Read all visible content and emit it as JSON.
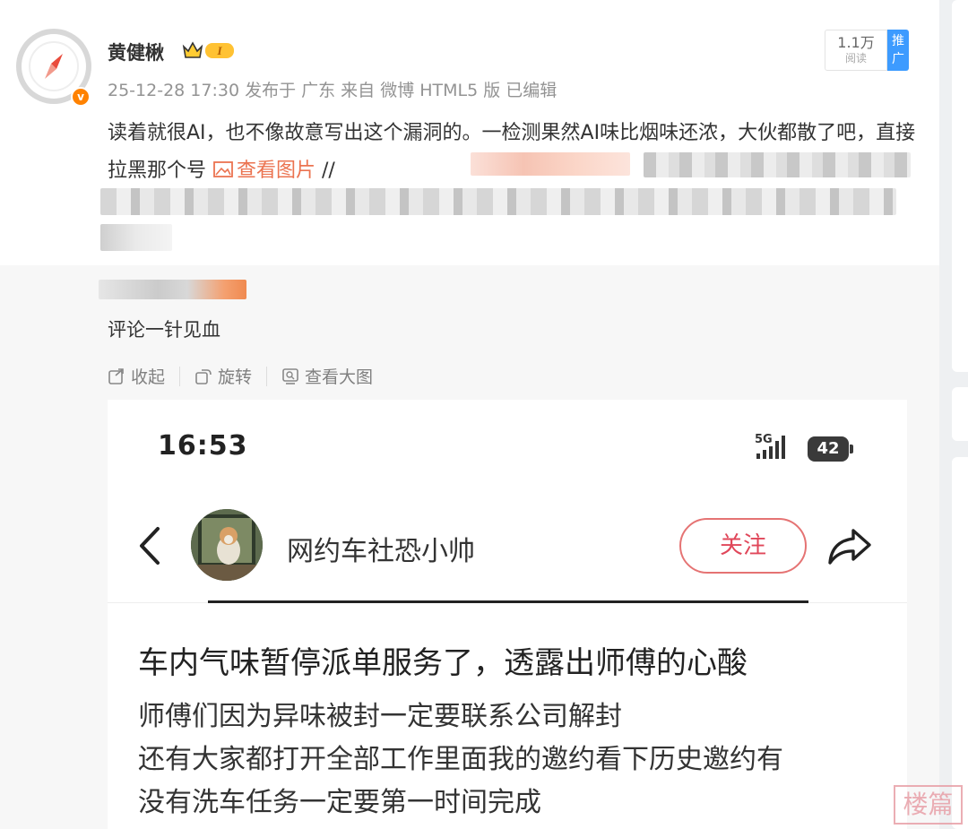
{
  "post": {
    "username": "黄健楸",
    "level_badge": "I",
    "meta": "25-12-28 17:30 发布于 广东 来自 微博 HTML5 版 已编辑",
    "read_count": "1.1万",
    "read_label": "阅读",
    "promote_label": "推广",
    "text_part1": "读着就很AI，也不像故意写出这个漏洞的。一检测果然AI味比烟味还浓，大伙都散了吧，直接拉黑那个号 ",
    "view_image_label": "查看图片",
    "text_part2": " //"
  },
  "retweet": {
    "comment": "评论一针见血"
  },
  "actions": {
    "collapse_label": "收起",
    "rotate_label": "旋转",
    "view_large_label": "查看大图"
  },
  "screenshot": {
    "time": "16:53",
    "network": "5G",
    "battery": "42",
    "account_name": "网约车社恐小帅",
    "follow_label": "关注",
    "title": "车内气味暂停派单服务了，透露出师傅的心酸",
    "body_lines": [
      "师傅们因为异味被封一定要联系公司解封",
      "还有大家都打开全部工作里面我的邀约看下历史邀约有",
      "没有洗车任务一定要第一时间完成"
    ]
  },
  "watermark": "楼篇",
  "colors": {
    "link_orange": "#eb7350",
    "promote_blue": "#3d9bff",
    "follow_red": "#e0475a"
  }
}
